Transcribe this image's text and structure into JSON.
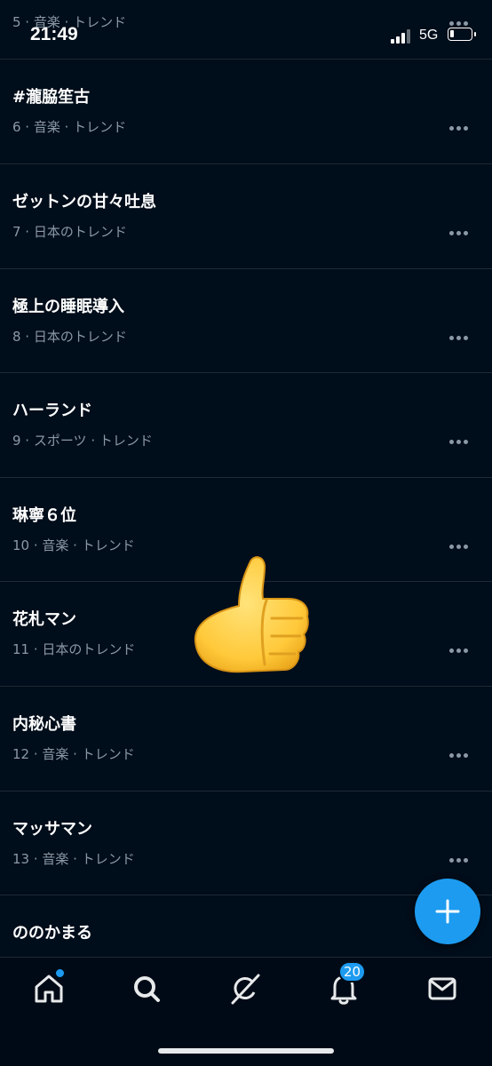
{
  "status_bar": {
    "time": "21:49",
    "network": "5G",
    "battery_level": 0.2
  },
  "trends": [
    {
      "title": "",
      "meta": "5 · 音楽 · トレンド"
    },
    {
      "title": "#瀧脇笙古",
      "meta": "6 · 音楽 · トレンド"
    },
    {
      "title": "ゼットンの甘々吐息",
      "meta": "7 · 日本のトレンド"
    },
    {
      "title": "極上の睡眠導入",
      "meta": "8 · 日本のトレンド"
    },
    {
      "title": "ハーランド",
      "meta": "9 · スポーツ · トレンド"
    },
    {
      "title": "琳寧６位",
      "meta": "10 · 音楽 · トレンド"
    },
    {
      "title": "花札マン",
      "meta": "11 · 日本のトレンド"
    },
    {
      "title": "内秘心書",
      "meta": "12 · 音楽 · トレンド"
    },
    {
      "title": "マッサマン",
      "meta": "13 · 音楽 · トレンド"
    },
    {
      "title": "ののかまる",
      "meta": ""
    }
  ],
  "overlay": {
    "emoji": "thumbs-up-emoji"
  },
  "fab": {
    "icon": "plus-icon"
  },
  "bottom_nav": {
    "items": [
      {
        "icon": "home-icon"
      },
      {
        "icon": "search-icon"
      },
      {
        "icon": "grok-icon"
      },
      {
        "icon": "bell-icon",
        "badge": "20"
      },
      {
        "icon": "mail-icon"
      }
    ]
  },
  "colors": {
    "background": "#000d1a",
    "accent": "#1d9bf0",
    "text": "#e7e9ea",
    "secondary": "#8b98a5"
  }
}
